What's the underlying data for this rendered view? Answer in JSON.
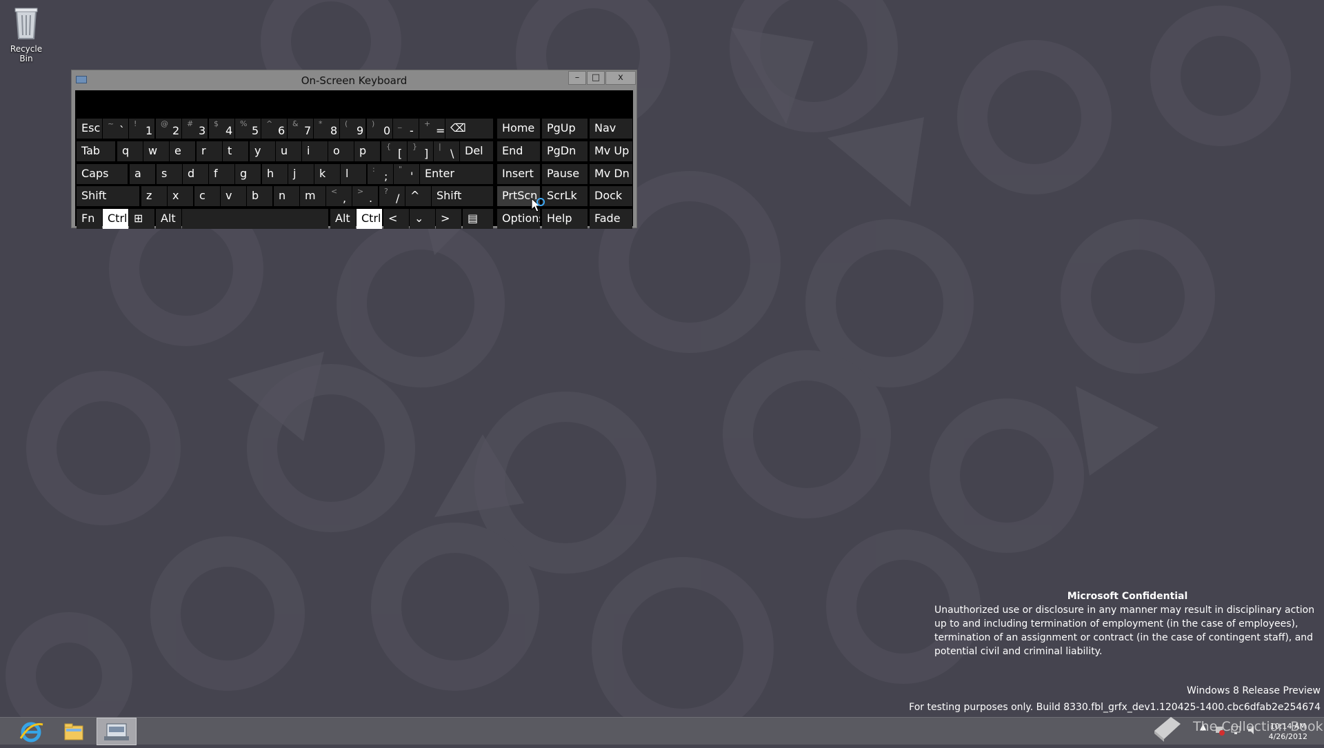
{
  "desktop": {
    "recycle_bin_label": "Recycle Bin"
  },
  "osk": {
    "title": "On-Screen Keyboard",
    "min_glyph": "–",
    "max_glyph": "□",
    "close_glyph": "x",
    "rows": [
      [
        {
          "l": "Esc"
        },
        {
          "s": "~",
          "m": "`"
        },
        {
          "s": "!",
          "m": "1"
        },
        {
          "s": "@",
          "m": "2"
        },
        {
          "s": "#",
          "m": "3"
        },
        {
          "s": "$",
          "m": "4"
        },
        {
          "s": "%",
          "m": "5"
        },
        {
          "s": "^",
          "m": "6"
        },
        {
          "s": "&",
          "m": "7"
        },
        {
          "s": "*",
          "m": "8"
        },
        {
          "s": "(",
          "m": "9"
        },
        {
          "s": ")",
          "m": "0"
        },
        {
          "s": "_",
          "m": "-"
        },
        {
          "s": "+",
          "m": "="
        },
        {
          "l": "⌫"
        }
      ],
      [
        {
          "l": "Tab"
        },
        {
          "l": "q"
        },
        {
          "l": "w"
        },
        {
          "l": "e"
        },
        {
          "l": "r"
        },
        {
          "l": "t"
        },
        {
          "l": "y"
        },
        {
          "l": "u"
        },
        {
          "l": "i"
        },
        {
          "l": "o"
        },
        {
          "l": "p"
        },
        {
          "s": "{",
          "m": "["
        },
        {
          "s": "}",
          "m": "]"
        },
        {
          "s": "|",
          "m": "\\"
        },
        {
          "l": "Del"
        }
      ],
      [
        {
          "l": "Caps"
        },
        {
          "l": "a"
        },
        {
          "l": "s"
        },
        {
          "l": "d"
        },
        {
          "l": "f"
        },
        {
          "l": "g"
        },
        {
          "l": "h"
        },
        {
          "l": "j"
        },
        {
          "l": "k"
        },
        {
          "l": "l"
        },
        {
          "s": ":",
          "m": ";"
        },
        {
          "s": "\"",
          "m": "'"
        },
        {
          "l": "Enter"
        }
      ],
      [
        {
          "l": "Shift"
        },
        {
          "l": "z"
        },
        {
          "l": "x"
        },
        {
          "l": "c"
        },
        {
          "l": "v"
        },
        {
          "l": "b"
        },
        {
          "l": "n"
        },
        {
          "l": "m"
        },
        {
          "s": "<",
          "m": ","
        },
        {
          "s": ">",
          "m": "."
        },
        {
          "s": "?",
          "m": "/"
        },
        {
          "l": "^"
        },
        {
          "l": "Shift"
        }
      ],
      [
        {
          "l": "Fn"
        },
        {
          "l": "Ctrl"
        },
        {
          "l": "⊞"
        },
        {
          "l": "Alt"
        },
        {
          "l": ""
        },
        {
          "l": "Alt"
        },
        {
          "l": "Ctrl"
        },
        {
          "l": "<"
        },
        {
          "l": "⌄"
        },
        {
          "l": ">"
        },
        {
          "l": "▤"
        }
      ]
    ],
    "nav_keys": [
      [
        "Home",
        "PgUp",
        "Nav"
      ],
      [
        "End",
        "PgDn",
        "Mv Up"
      ],
      [
        "Insert",
        "Pause",
        "Mv Dn"
      ],
      [
        "PrtScn",
        "ScrLk",
        "Dock"
      ],
      [
        "Options",
        "Help",
        "Fade"
      ]
    ]
  },
  "watermark": {
    "heading": "Microsoft Confidential",
    "body": "Unauthorized use or disclosure in any manner may result in disciplinary action up to and including termination of employment (in the case of employees), termination of an assignment or contract (in the case of contingent staff), and potential civil and criminal liability.",
    "version": "Windows 8 Release Preview",
    "build": "For testing purposes only. Build 8330.fbl_grfx_dev1.120425-1400.cbc6dfab2e254674"
  },
  "taskbar": {
    "clock_time": "10:14 AM",
    "clock_date": "4/26/2012",
    "tray_up": "▲",
    "brand": "The Collection Book"
  },
  "colors": {
    "desktop_bg": "#45444f",
    "key_bg": "#222222",
    "key_active": "#ffffff",
    "taskbar": "#5a5a61"
  }
}
